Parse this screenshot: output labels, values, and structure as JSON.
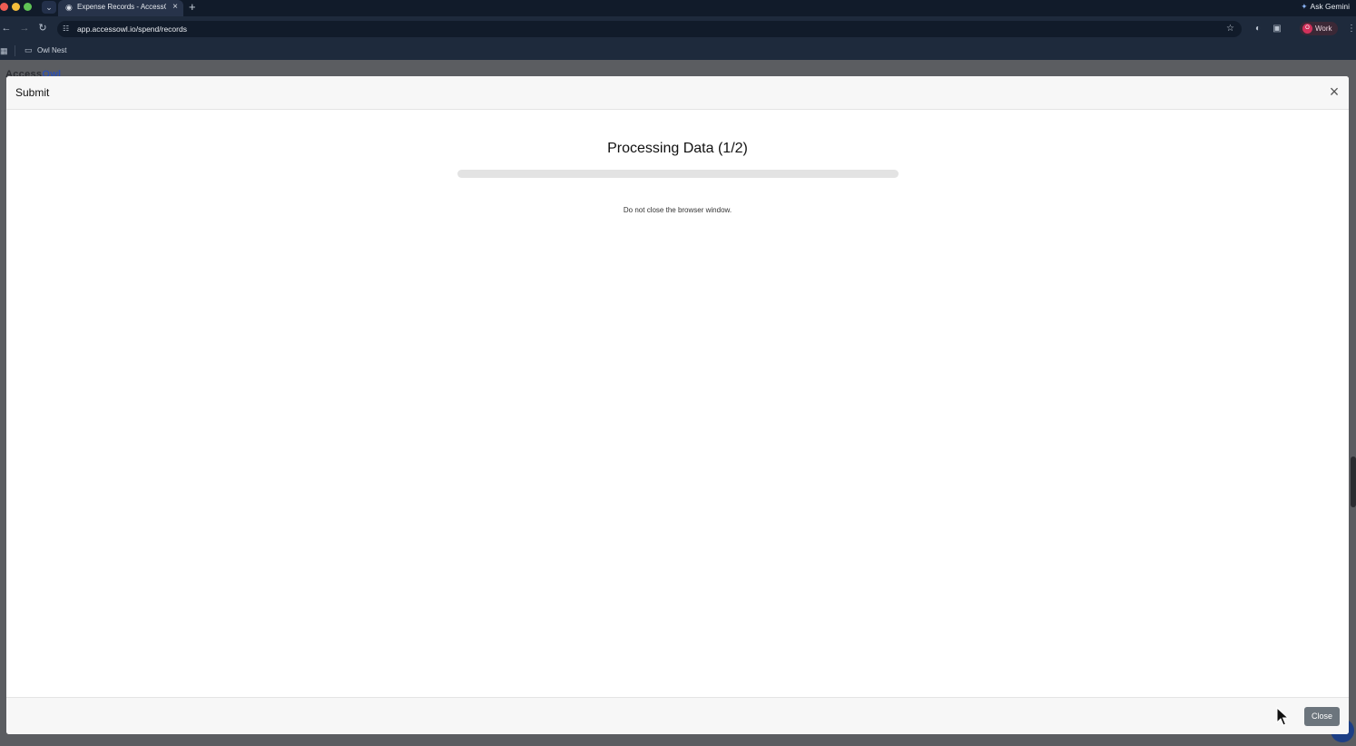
{
  "browser": {
    "tab_title": "Expense Records - AccessOwl",
    "url": "app.accessowl.io/spend/records",
    "gemini_label": "Ask Gemini",
    "profile_initial": "O",
    "profile_label": "Work",
    "bookmark_folder": "Owl Nest"
  },
  "background_page": {
    "brand_prefix": "Access",
    "brand_suffix": "Owl"
  },
  "modal": {
    "title": "Submit",
    "heading": "Processing Data (1/2)",
    "progress_fraction": 0.0,
    "note": "Do not close the browser window.",
    "close_label": "Close"
  },
  "colors": {
    "accent_button": "#6c757d",
    "progress_track": "#e3e3e3"
  },
  "icons": [
    "close-icon",
    "star-icon",
    "menu-icon",
    "folder-icon",
    "mouse-cursor-icon"
  ]
}
